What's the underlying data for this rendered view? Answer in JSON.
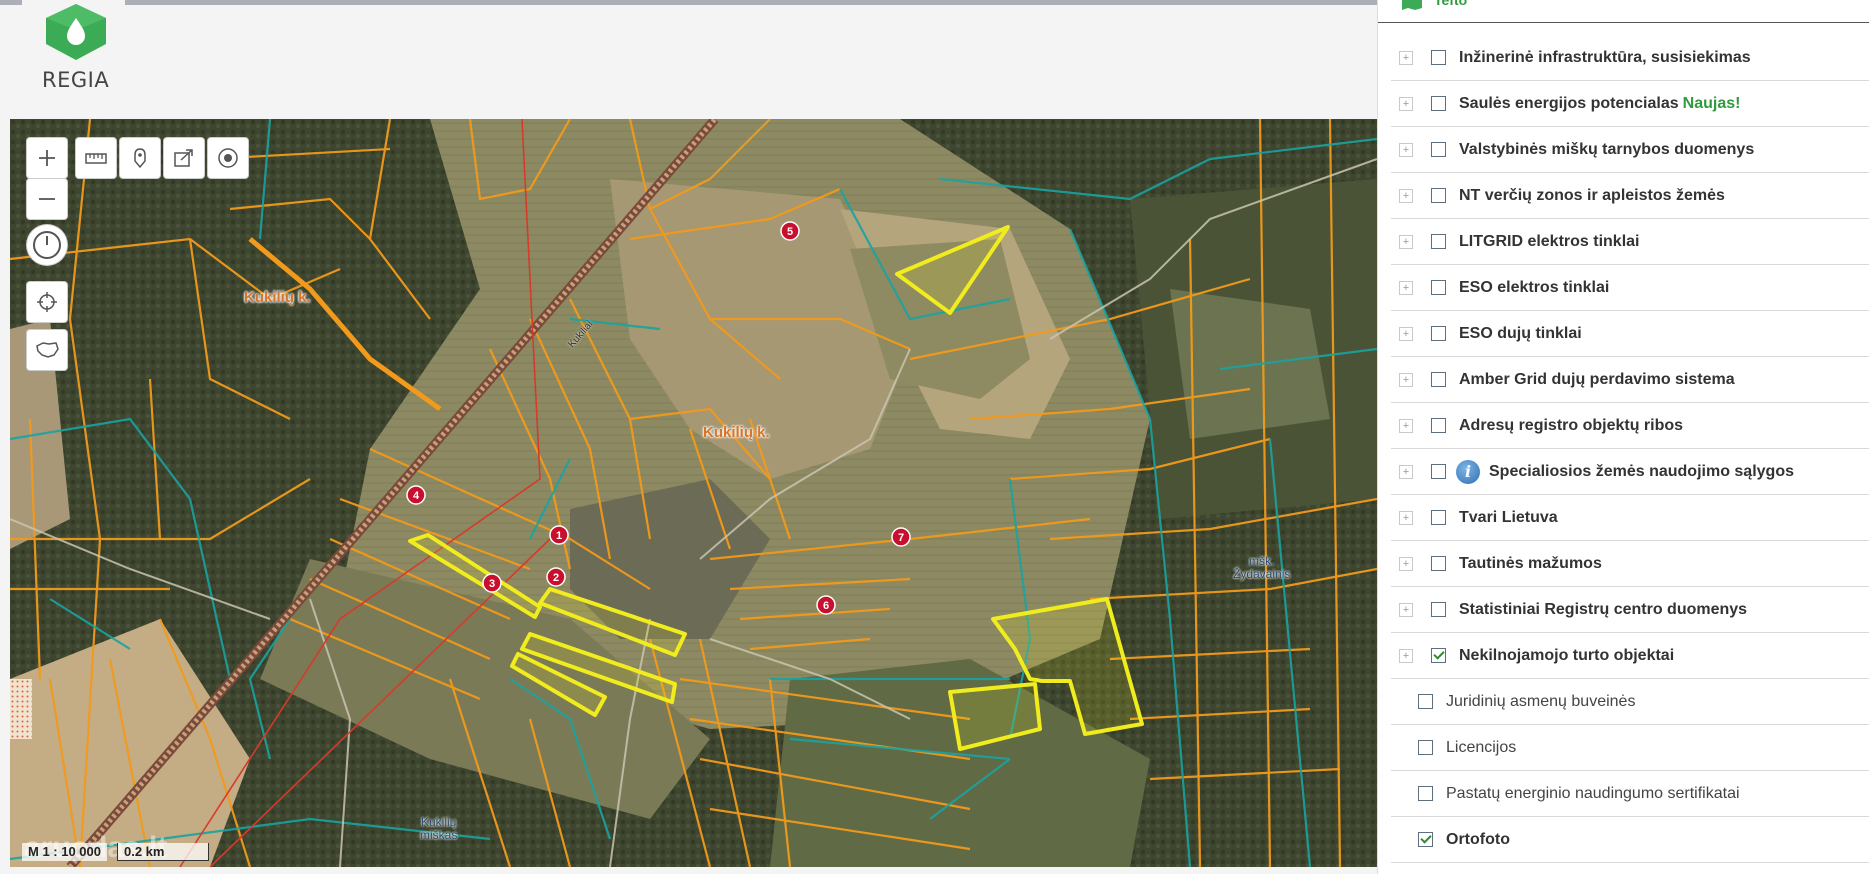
{
  "app": {
    "logo_text": "REGIA",
    "brand_color": "#3cab56"
  },
  "map": {
    "controls": {
      "zoom_in": "+",
      "zoom_out": "−"
    },
    "place_labels": [
      {
        "id": "kukiliu-1",
        "text": "Kukilių k."
      },
      {
        "id": "kukiliu-2",
        "text": "Kukilių k."
      }
    ],
    "small_labels": [
      {
        "id": "zydavainis",
        "lines": [
          "mšk.",
          "Žydavainis"
        ]
      },
      {
        "id": "kukiliu-miskas",
        "lines": [
          "Kukilių",
          "miškas"
        ]
      }
    ],
    "road_label": "Kukiliai",
    "parcels": [
      "1",
      "2",
      "3",
      "4",
      "5",
      "6",
      "7"
    ],
    "scale": {
      "ratio": "M 1 : 10 000",
      "distance": "0.2 km"
    },
    "watermark": "aruodas.lt",
    "colors": {
      "parcel_outline": "#f0ec1e",
      "parcel_fill": "rgba(240,236,30,0.18)",
      "marker": "#c8102e",
      "cadastre_orange": "#f29a1b",
      "cadastre_teal": "#1aa3a0",
      "railway": "#b0704f",
      "powerline": "#d83a2a"
    }
  },
  "panel": {
    "top_item": "Tefto",
    "layers": [
      {
        "label": "Inžinerinė infrastruktūra, susisiekimas",
        "checked": false,
        "expandable": true
      },
      {
        "label": "Saulės energijos potencialas",
        "badge": "Naujas!",
        "checked": false,
        "expandable": true
      },
      {
        "label": "Valstybinės miškų tarnybos duomenys",
        "checked": false,
        "expandable": true
      },
      {
        "label": "NT verčių zonos ir apleistos žemės",
        "checked": false,
        "expandable": true
      },
      {
        "label": "LITGRID elektros tinklai",
        "checked": false,
        "expandable": true
      },
      {
        "label": "ESO elektros tinklai",
        "checked": false,
        "expandable": true
      },
      {
        "label": "ESO dujų tinklai",
        "checked": false,
        "expandable": true
      },
      {
        "label": "Amber Grid dujų perdavimo sistema",
        "checked": false,
        "expandable": true
      },
      {
        "label": "Adresų registro objektų ribos",
        "checked": false,
        "expandable": true
      },
      {
        "label": "Specialiosios žemės naudojimo sąlygos",
        "checked": false,
        "expandable": true,
        "info_icon": true
      },
      {
        "label": "Tvari Lietuva",
        "checked": false,
        "expandable": true
      },
      {
        "label": "Tautinės mažumos",
        "checked": false,
        "expandable": true
      },
      {
        "label": "Statistiniai Registrų centro duomenys",
        "checked": false,
        "expandable": true
      },
      {
        "label": "Nekilnojamojo turto objektai",
        "checked": true,
        "expandable": true
      },
      {
        "label": "Juridinių asmenų buveinės",
        "checked": false,
        "expandable": false
      },
      {
        "label": "Licencijos",
        "checked": false,
        "expandable": false
      },
      {
        "label": "Pastatų energinio naudingumo sertifikatai",
        "checked": false,
        "expandable": false
      },
      {
        "label": "Ortofoto",
        "checked": true,
        "expandable": false,
        "bold": true
      }
    ]
  }
}
